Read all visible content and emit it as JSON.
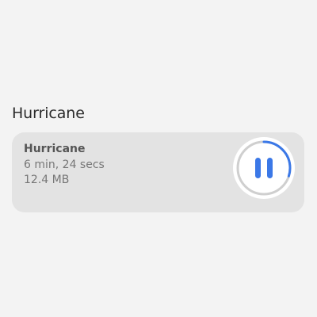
{
  "section": {
    "title": "Hurricane"
  },
  "download_card": {
    "title": "Hurricane",
    "duration": "6 min, 24 secs",
    "size": "12.4 MB",
    "progress_fraction": 0.3,
    "state": "downloading",
    "control_icon": "pause-icon"
  },
  "colors": {
    "background": "#f3f3f3",
    "card_background": "#e3e3e3",
    "accent": "#3b78e7",
    "track": "#cfcfcf"
  }
}
